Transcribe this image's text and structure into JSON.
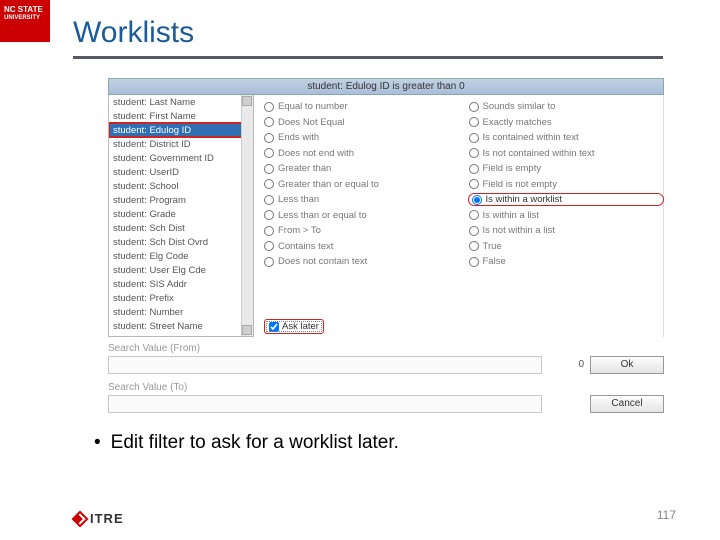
{
  "brand": {
    "line1": "NC STATE",
    "line2": "UNIVERSITY"
  },
  "title": "Worklists",
  "filter_bar": "student: Edulog ID   is greater than 0",
  "fields": [
    "student: Last Name",
    "student: First Name",
    "student: Edulog ID",
    "student: District ID",
    "student: Government ID",
    "student: UserID",
    "student: School",
    "student: Program",
    "student: Grade",
    "student: Sch Dist",
    "student: Sch Dist Ovrd",
    "student: Elg Code",
    "student: User Elg Cde",
    "student: SIS Addr",
    "student: Prefix",
    "student: Number",
    "student: Street Name"
  ],
  "selected_field_index": 2,
  "ops_col1": [
    "Equal to number",
    "Does Not Equal",
    "Ends with",
    "Does not end with",
    "Greater than",
    "Greater than or equal to",
    "Less than",
    "Less than or equal to",
    "From  > To",
    "Contains text",
    "Does not contain text"
  ],
  "ops_col2": [
    "Sounds similar to",
    "Exactly matches",
    "Is contained within text",
    "Is not contained within text",
    "Field is empty",
    "Field is not empty",
    "Is within a worklist",
    "Is within a list",
    "Is not within a list",
    "True",
    "False"
  ],
  "selected_op_col2_index": 6,
  "ask_later": {
    "label": "Ask later",
    "checked": true
  },
  "search_from": {
    "label": "Search Value (From)",
    "value": "0"
  },
  "search_to": {
    "label": "Search Value (To)",
    "value": ""
  },
  "buttons": {
    "ok": "Ok",
    "cancel": "Cancel"
  },
  "bullet": "Edit filter to ask for a worklist later.",
  "footer_logo": "ITRE",
  "page_number": "117"
}
